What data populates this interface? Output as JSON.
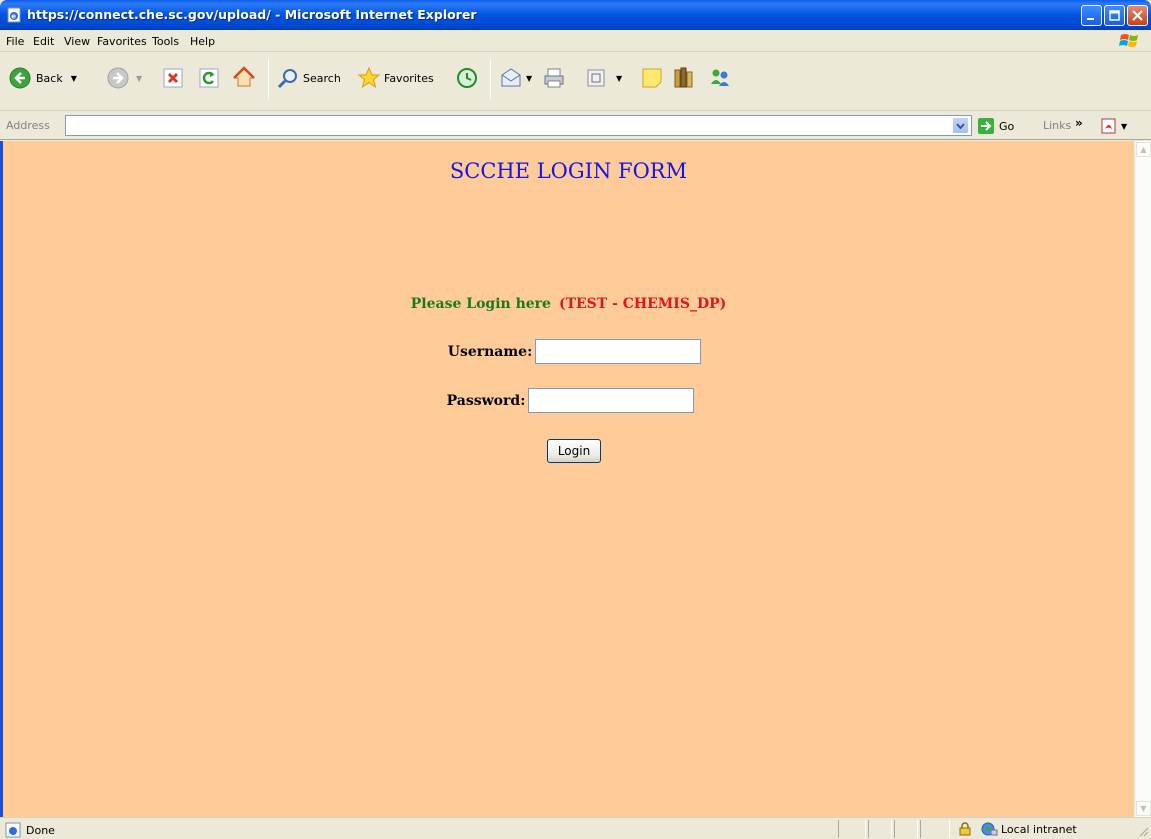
{
  "window": {
    "title": "https://connect.che.sc.gov/upload/ - Microsoft Internet Explorer"
  },
  "menu": {
    "items": [
      {
        "label": "File"
      },
      {
        "label": "Edit"
      },
      {
        "label": "View"
      },
      {
        "label": "Favorites"
      },
      {
        "label": "Tools"
      },
      {
        "label": "Help"
      }
    ]
  },
  "toolbar": {
    "back_label": "Back",
    "search_label": "Search",
    "favorites_label": "Favorites"
  },
  "address": {
    "label": "Address",
    "value": "",
    "go_label": "Go",
    "links_label": "Links"
  },
  "page": {
    "title": "SCCHE LOGIN FORM",
    "prompt": "Please Login here",
    "environment": "(TEST - CHEMIS_DP)",
    "username_label": "Username",
    "username_value": "",
    "password_label": "Password",
    "password_value": "",
    "login_button": "Login",
    "background_color": "#FFCC99",
    "title_color": "#1515E6",
    "prompt_color": "#1A7A1A",
    "environment_color": "#E01515"
  },
  "status": {
    "text": "Done",
    "zone": "Local intranet"
  }
}
